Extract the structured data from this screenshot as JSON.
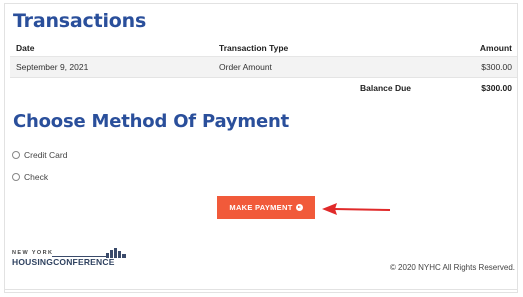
{
  "transactions": {
    "title": "Transactions",
    "columns": {
      "date": "Date",
      "type": "Transaction Type",
      "amount": "Amount"
    },
    "rows": [
      {
        "date": "September 9, 2021",
        "type": "Order Amount",
        "amount": "$300.00"
      }
    ],
    "balance_label": "Balance Due",
    "balance_value": "$300.00"
  },
  "payment": {
    "title": "Choose Method Of Payment",
    "options": [
      "Credit Card",
      "Check"
    ],
    "button_label": "MAKE PAYMENT"
  },
  "footer": {
    "logo_line1": "NEW YORK",
    "logo_line2": "HOUSINGCONFERENCE",
    "copyright": "© 2020 NYHC All Rights Reserved."
  },
  "colors": {
    "heading": "#2a4f9b",
    "button": "#f15a3a",
    "annotation_arrow": "#e02a2a"
  }
}
